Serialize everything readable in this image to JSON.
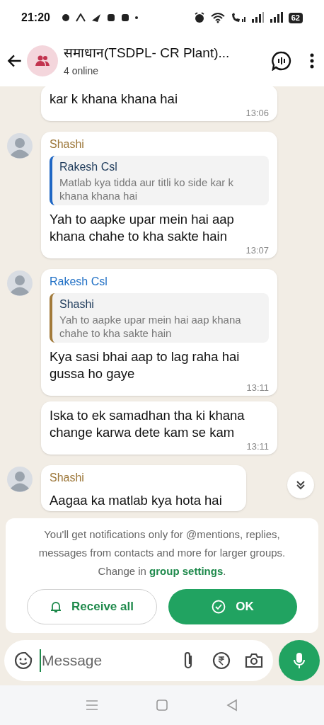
{
  "status_bar": {
    "time": "21:20",
    "battery": "62"
  },
  "header": {
    "title": "समाधान(TSDPL- CR Plant)...",
    "subtitle": "4 online"
  },
  "messages": [
    {
      "kind": "continuation",
      "text": "kar k khana khana hai",
      "time": "13:06"
    },
    {
      "kind": "first",
      "sender": "Shashi",
      "color": "#9c7638",
      "reply": {
        "sender": "Rakesh Csl",
        "text": "Matlab kya tidda aur titli ko side kar k khana khana hai",
        "color": "#1f67c4"
      },
      "text": "Yah to aapke upar mein hai aap khana chahe to kha sakte hain",
      "time": "13:07"
    },
    {
      "kind": "first",
      "sender": "Rakesh Csl",
      "color": "#1f6fc5",
      "reply": {
        "sender": "Shashi",
        "text": "Yah to aapke upar mein hai aap khana chahe to kha sakte hain",
        "color": "#a27a3a"
      },
      "text": "Kya sasi bhai aap to lag raha hai gussa ho gaye",
      "time": "13:11"
    },
    {
      "kind": "continuation",
      "text": "Iska to ek samadhan tha ki khana change karwa dete kam se kam",
      "time": "13:11"
    },
    {
      "kind": "first",
      "sender": "Shashi",
      "color": "#9c7638",
      "text": "Aagaa ka matlab kya hota hai"
    }
  ],
  "notice": {
    "text": "You'll get notifications only for @mentions, replies, messages from contacts and more for larger groups. Change in",
    "link": "group settings",
    "after": "."
  },
  "buttons": [
    "Receive all",
    "OK"
  ],
  "composer": {
    "placeholder": "Message"
  }
}
